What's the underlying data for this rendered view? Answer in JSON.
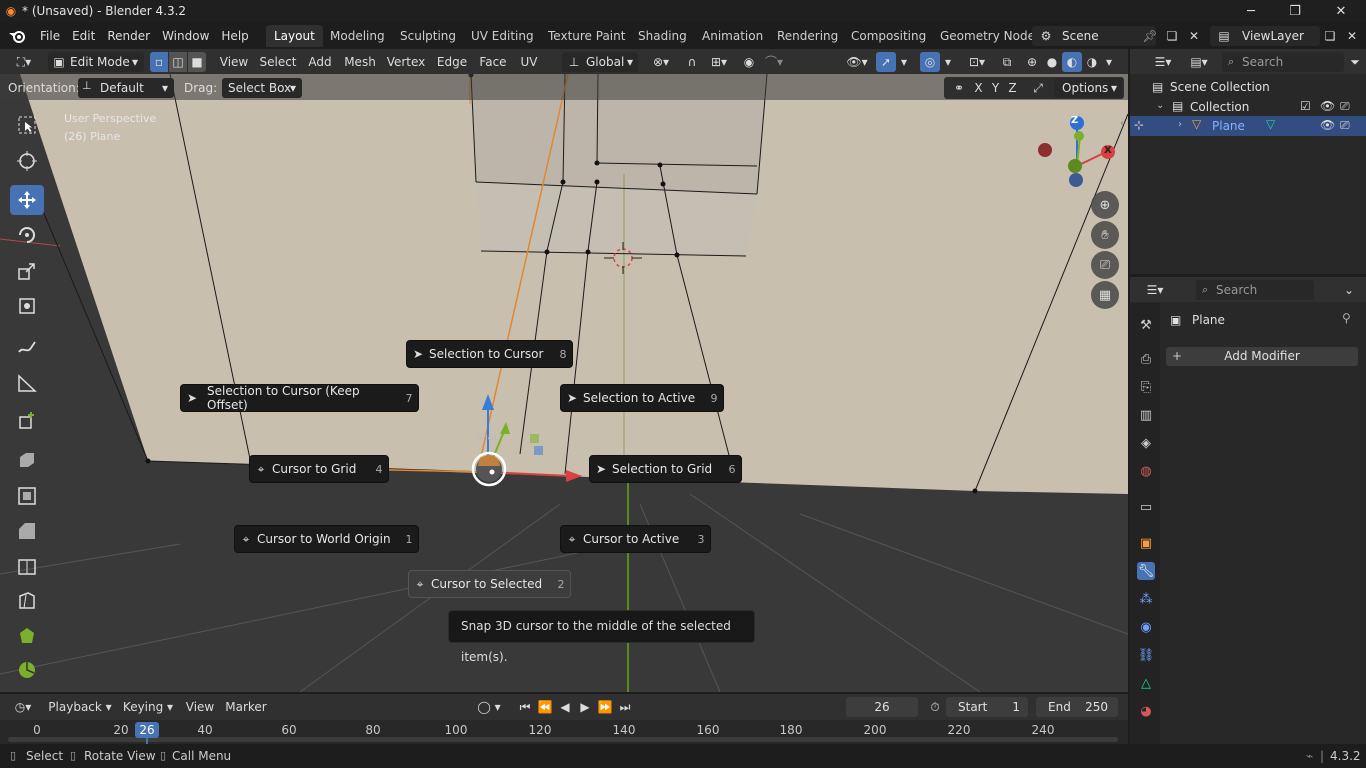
{
  "window": {
    "title": "* (Unsaved) - Blender 4.3.2"
  },
  "menubar": {
    "items": [
      "File",
      "Edit",
      "Render",
      "Window",
      "Help"
    ]
  },
  "workspaces": [
    "Layout",
    "Modeling",
    "Sculpting",
    "UV Editing",
    "Texture Paint",
    "Shading",
    "Animation",
    "Rendering",
    "Compositing",
    "Geometry Node"
  ],
  "scene": {
    "name": "Scene",
    "view_layer": "ViewLayer"
  },
  "header": {
    "mode": "Edit Mode",
    "menus": [
      "View",
      "Select",
      "Add",
      "Mesh",
      "Vertex",
      "Edge",
      "Face",
      "UV"
    ],
    "transform_orientation": "Global"
  },
  "tool_settings": {
    "orientation_label": "Orientation:",
    "orientation_value": "Default",
    "drag_label": "Drag:",
    "drag_value": "Select Box",
    "axes": [
      "X",
      "Y",
      "Z"
    ],
    "options_label": "Options"
  },
  "viewport": {
    "overlay_line1": "User Perspective",
    "overlay_line2": "(26) Plane",
    "snap_label": "Snap",
    "gizmo_labels": {
      "z": "Z",
      "x": "X"
    }
  },
  "pie_menu": {
    "items": [
      {
        "label": "Selection to Cursor",
        "key": "8",
        "icon": "cursor-arrow-icon"
      },
      {
        "label": "Selection to Cursor (Keep Offset)",
        "key": "7",
        "icon": "cursor-arrow-icon"
      },
      {
        "label": "Selection to Active",
        "key": "9",
        "icon": "cursor-arrow-icon"
      },
      {
        "label": "Cursor to Grid",
        "key": "4",
        "icon": "cursor-target-icon"
      },
      {
        "label": "Selection to Grid",
        "key": "6",
        "icon": "cursor-arrow-icon"
      },
      {
        "label": "Cursor to World Origin",
        "key": "1",
        "icon": "cursor-target-icon"
      },
      {
        "label": "Cursor to Active",
        "key": "3",
        "icon": "cursor-target-icon"
      },
      {
        "label": "Cursor to Selected",
        "key": "2",
        "icon": "cursor-target-icon"
      }
    ],
    "tooltip": "Snap 3D cursor to the middle of the selected item(s)."
  },
  "outliner": {
    "search_placeholder": "Search",
    "rows": [
      {
        "label": "Scene Collection"
      },
      {
        "label": "Collection"
      },
      {
        "label": "Plane"
      }
    ]
  },
  "properties": {
    "search_placeholder": "Search",
    "object_name": "Plane",
    "add_modifier_label": "Add Modifier"
  },
  "timeline": {
    "menus": [
      "Playback",
      "Keying",
      "View",
      "Marker"
    ],
    "current_frame": "26",
    "start_label": "Start",
    "start_value": "1",
    "end_label": "End",
    "end_value": "250",
    "ticks": [
      "0",
      "20",
      "40",
      "60",
      "80",
      "100",
      "120",
      "140",
      "160",
      "180",
      "200",
      "220",
      "240"
    ],
    "playhead": "26"
  },
  "statusbar": {
    "items": [
      "Select",
      "Rotate View",
      "Call Menu"
    ],
    "version": "4.3.2"
  },
  "colors": {
    "accent": "#4772b3",
    "wall": "#c9bfaf",
    "floor": "#393939",
    "x_axis": "#d9403f",
    "y_axis": "#7ab02c",
    "z_axis": "#2e6fd8"
  }
}
